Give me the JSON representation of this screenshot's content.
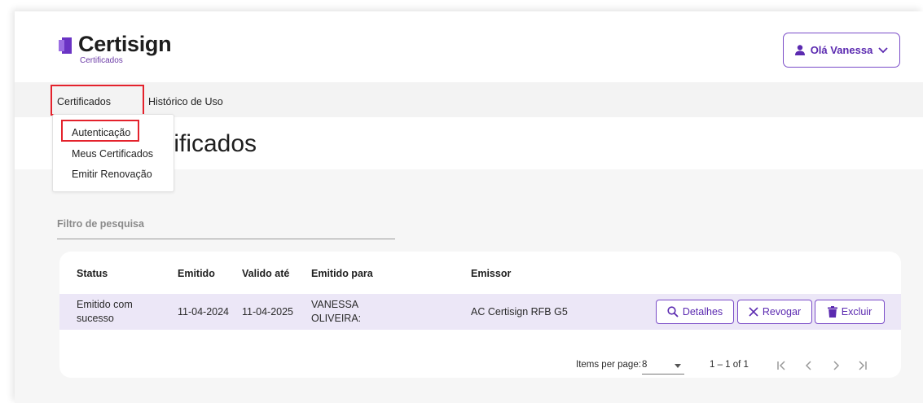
{
  "brand": {
    "name": "Certisign",
    "subtitle": "Certificados",
    "accent": "#7a4cc8",
    "highlight": "#e4222c"
  },
  "user": {
    "label": "Olá Vanessa",
    "icon": "person-icon",
    "chevron": "chevron-down-icon"
  },
  "nav": {
    "items": [
      {
        "label": "Certificados"
      },
      {
        "label": "Histórico de Uso"
      }
    ]
  },
  "dropdown": {
    "items": [
      {
        "label": "Autenticação"
      },
      {
        "label": "Meus Certificados"
      },
      {
        "label": "Emitir Renovação"
      }
    ]
  },
  "page": {
    "title_visible": "tificados"
  },
  "filter": {
    "label": "Filtro de pesquisa",
    "value": ""
  },
  "table": {
    "columns": [
      "Status",
      "Emitido",
      "Valido até",
      "Emitido para",
      "Emissor"
    ],
    "rows": [
      {
        "status": "Emitido com sucesso",
        "emitido": "11-04-2024",
        "valido": "11-04-2025",
        "emitido_para": "VANESSA OLIVEIRA:",
        "emissor": "AC Certisign RFB G5"
      }
    ],
    "actions": {
      "details": "Detalhes",
      "revoke": "Revogar",
      "delete": "Excluir"
    }
  },
  "pagination": {
    "items_per_page_label": "Items per page:",
    "page_size": "8",
    "range": "1 – 1 of 1",
    "icons": [
      "first-page-icon",
      "prev-page-icon",
      "next-page-icon",
      "last-page-icon"
    ]
  }
}
